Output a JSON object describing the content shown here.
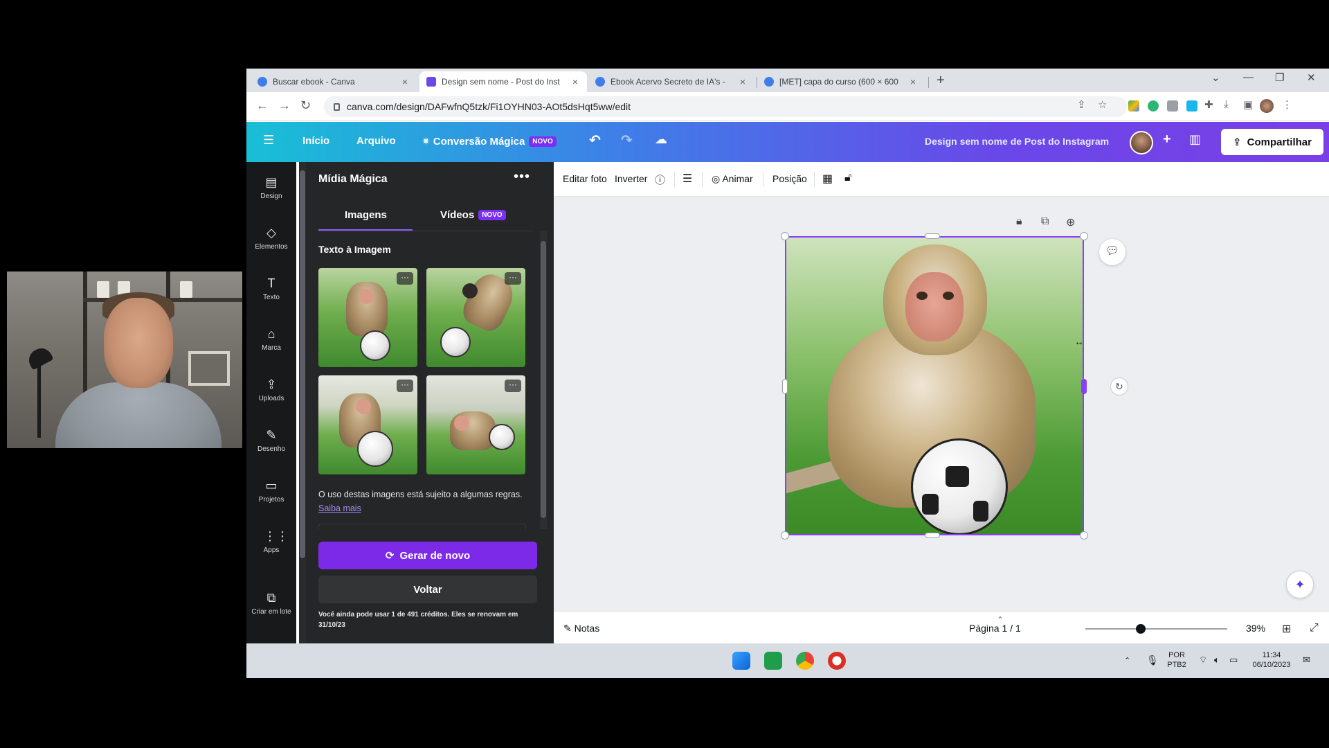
{
  "browser": {
    "tabs": [
      {
        "label": "Buscar ebook - Canva",
        "active": false,
        "favicon_color": "#3f7ee8"
      },
      {
        "label": "Design sem nome - Post do Inst",
        "active": true,
        "favicon_color": "#6a47e8"
      },
      {
        "label": "Ebook Acervo Secreto de IA's - ",
        "active": false,
        "favicon_color": "#3f7ee8"
      },
      {
        "label": "[MET] capa do curso (600 × 600",
        "active": false,
        "favicon_color": "#3f7ee8"
      }
    ],
    "new_tab": "+",
    "url": "canva.com/design/DAFwfnQ5tzk/Fi1OYHN03-AOt5dsHqt5ww/edit"
  },
  "header": {
    "menu_icon": "hamburger-icon",
    "inicio": "Início",
    "arquivo": "Arquivo",
    "conversao": "Conversão Mágica",
    "novo_badge": "NOVO",
    "design_title": "Design sem nome de Post do Instagram",
    "share": "Compartilhar",
    "plus": "+"
  },
  "rail": {
    "items": [
      {
        "label": "Design",
        "icon": "▤"
      },
      {
        "label": "Elementos",
        "icon": "◇"
      },
      {
        "label": "Texto",
        "icon": "T"
      },
      {
        "label": "Marca",
        "icon": "⌂"
      },
      {
        "label": "Uploads",
        "icon": "⇪"
      },
      {
        "label": "Desenho",
        "icon": "✎"
      },
      {
        "label": "Projetos",
        "icon": "▭"
      },
      {
        "label": "Apps",
        "icon": "⋮⋮"
      },
      {
        "label": "Criar em lote",
        "icon": "⧉"
      }
    ]
  },
  "panel": {
    "title": "Mídia Mágica",
    "more": "•••",
    "tab_images": "Imagens",
    "tab_videos": "Vídeos",
    "videos_badge": "NOVO",
    "section": "Texto à Imagem",
    "note_text": "O uso destas imagens está sujeito a algumas regras.",
    "note_link": "Saiba mais",
    "generate": "Gerar de novo",
    "back": "Voltar",
    "credits": "Você ainda pode usar 1 de 491 créditos. Eles se renovam em 31/10/23"
  },
  "toolbar": {
    "edit_photo": "Editar foto",
    "invert": "Inverter",
    "animate": "Animar",
    "position": "Posição"
  },
  "footer": {
    "notes": "Notas",
    "page": "Página 1 / 1",
    "zoom": "39%",
    "zoom_fraction": 0.39
  },
  "taskbar": {
    "lang": "POR",
    "layout": "PTB2",
    "time": "11:34",
    "date": "06/10/2023"
  }
}
